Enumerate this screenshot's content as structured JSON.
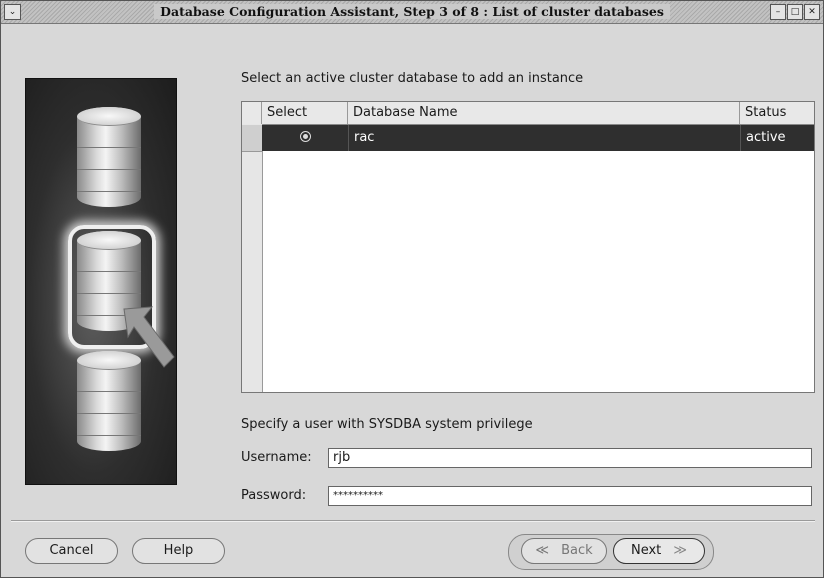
{
  "window": {
    "title": "Database Configuration Assistant, Step 3 of 8 : List of cluster databases",
    "menu_glyph": "⌄",
    "minimize_glyph": "–",
    "maximize_glyph": "□",
    "close_glyph": "✕"
  },
  "main": {
    "instruction": "Select an active cluster database to add an instance",
    "table": {
      "columns": [
        "Select",
        "Database Name",
        "Status"
      ],
      "rows": [
        {
          "selected": true,
          "database_name": "rac",
          "status": "active"
        }
      ]
    },
    "sysdba_prompt": "Specify a user with SYSDBA system privilege",
    "username_label": "Username:",
    "username_value": "rjb",
    "password_label": "Password:",
    "password_value": "**********"
  },
  "footer": {
    "cancel_label": "Cancel",
    "help_label": "Help",
    "back_label": "Back",
    "back_glyph": "≪",
    "next_label": "Next",
    "next_glyph": "≫"
  }
}
